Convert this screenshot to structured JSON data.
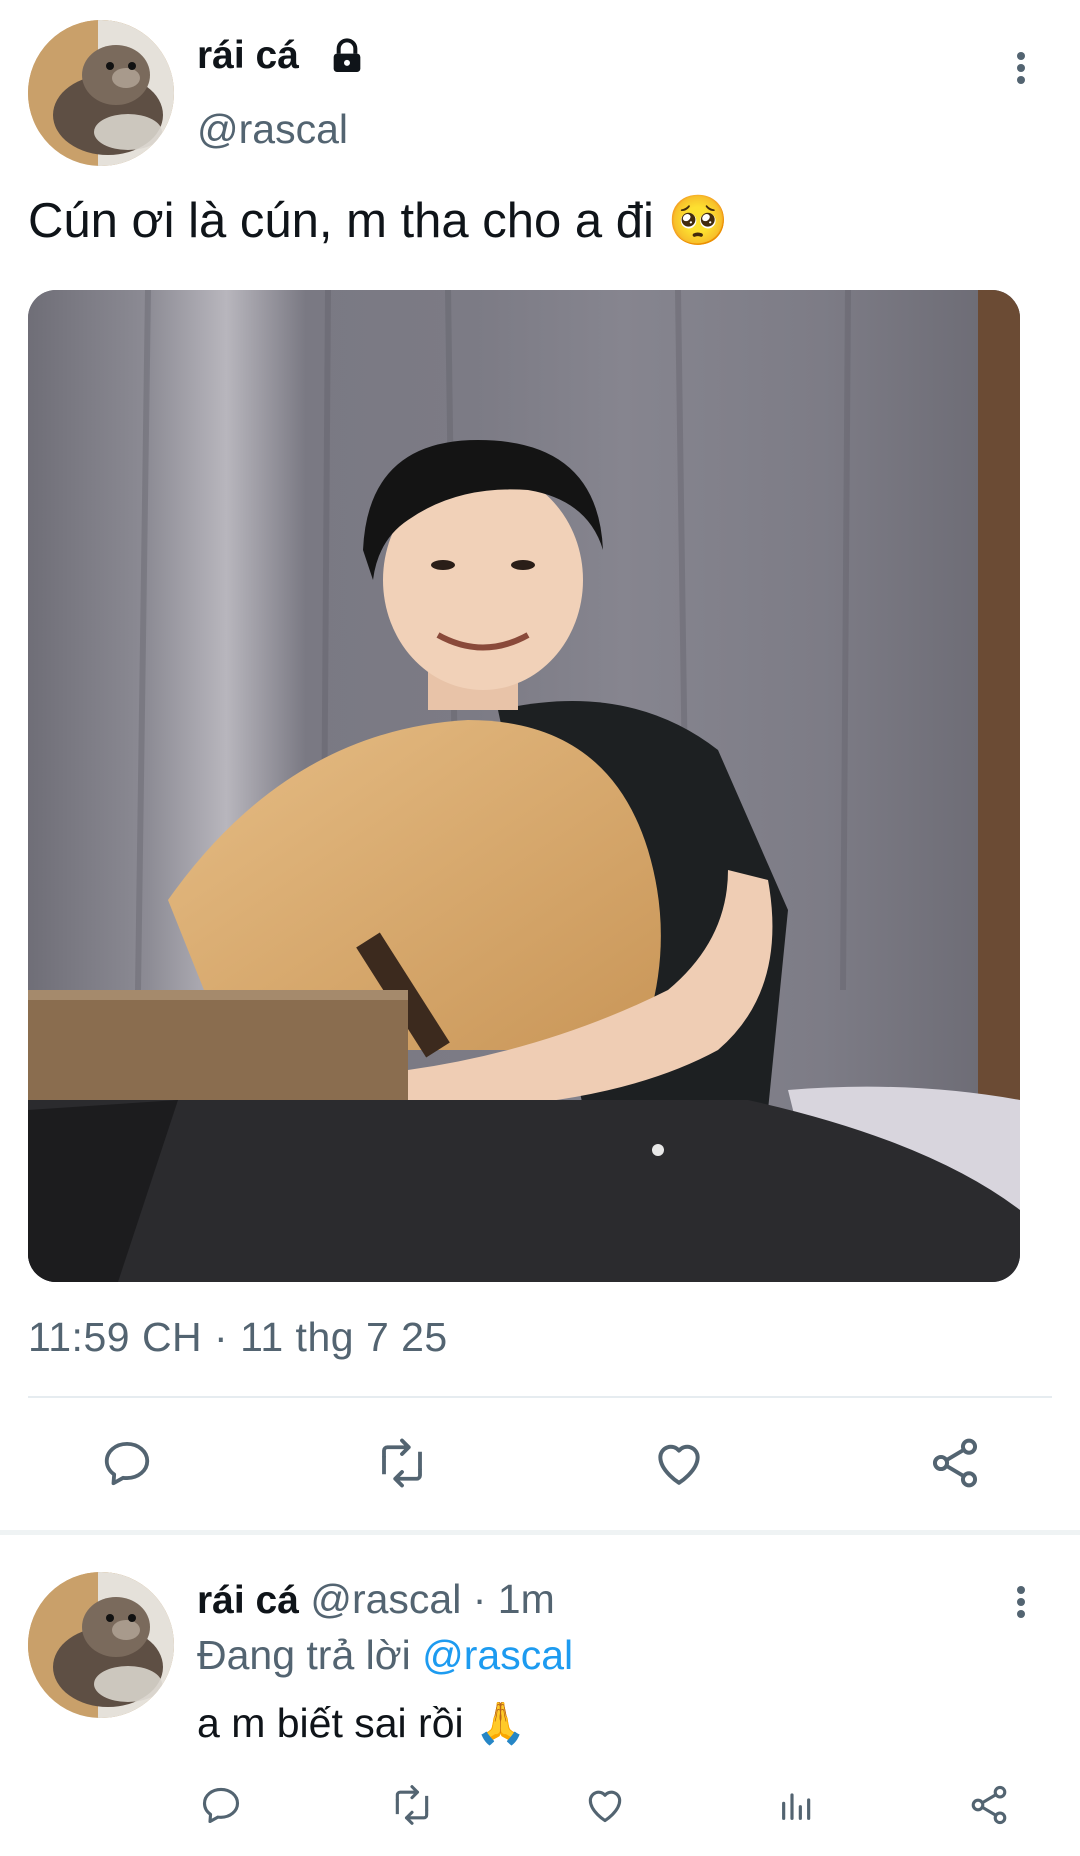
{
  "main_tweet": {
    "author_name": "rái cá",
    "author_handle": "@rascal",
    "text": "Cún ơi là cún, m tha cho a đi 🥺",
    "timestamp": "11:59 CH · 11 thg 7 25",
    "icons": [
      "lock-icon",
      "more-icon",
      "reply-icon",
      "retweet-icon",
      "like-icon",
      "share-icon"
    ]
  },
  "reply": {
    "author_name": "rái cá",
    "author_handle": "@rascal",
    "time": "· 1m",
    "replying_to_label": "Đang trả lời",
    "replying_to_handle": "@rascal",
    "text": "a m biết sai rồi 🙏",
    "icons": [
      "reply-icon",
      "retweet-icon",
      "like-icon",
      "views-icon",
      "share-icon"
    ]
  },
  "colors": {
    "accent": "#1d9bf0",
    "secondary_text": "#536471",
    "primary_text": "#0f1419"
  }
}
